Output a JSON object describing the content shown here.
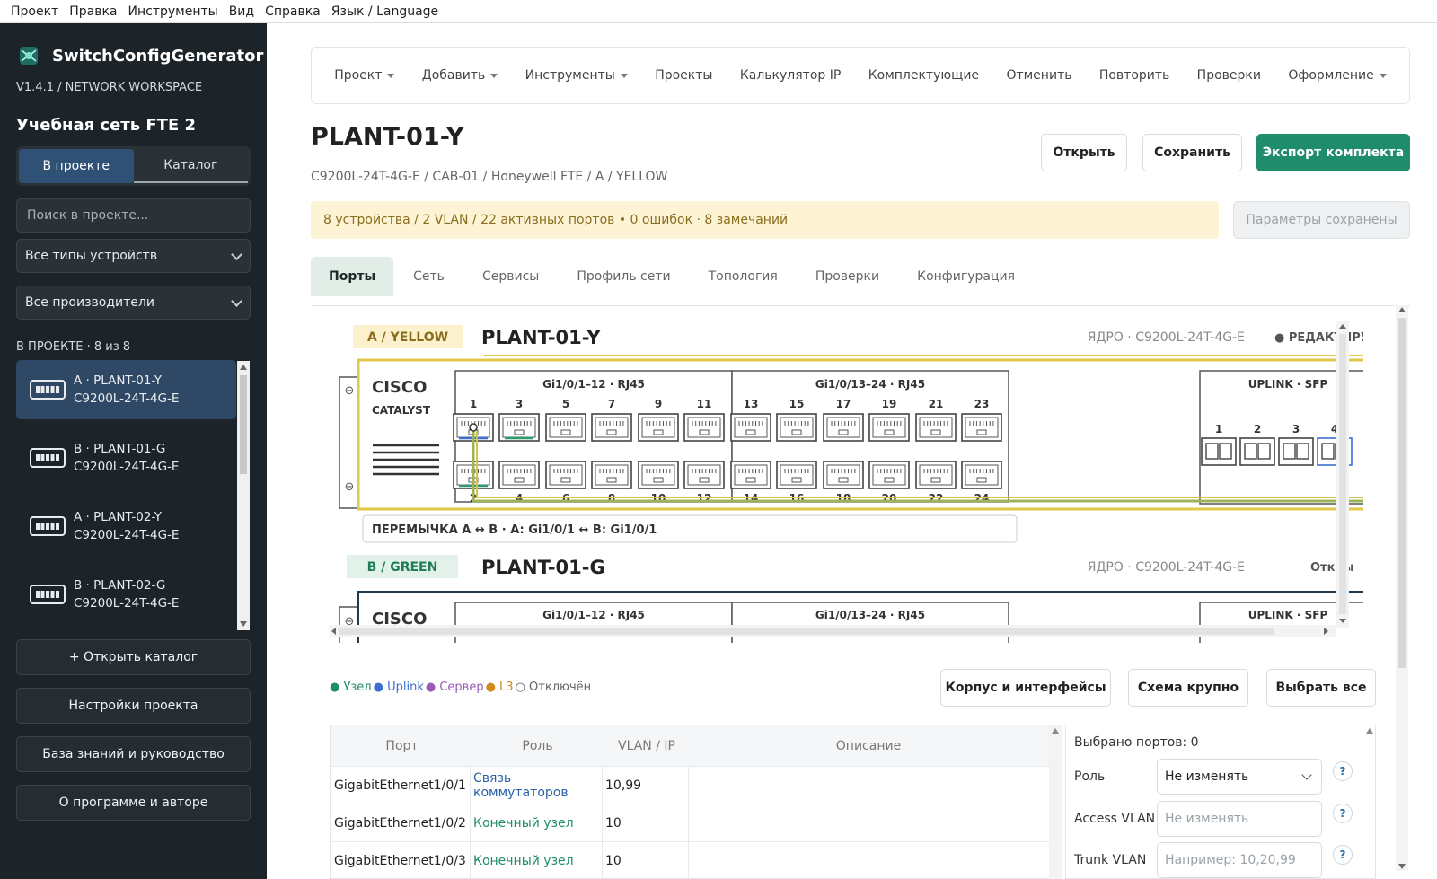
{
  "menubar": [
    "Проект",
    "Правка",
    "Инструменты",
    "Вид",
    "Справка",
    "Язык / Language"
  ],
  "sidebar": {
    "app_name": "SwitchConfigGenerator",
    "version": "V1.4.1   /   NETWORK WORKSPACE",
    "project_title": "Учебная сеть FTE 2",
    "tabs": [
      "В проекте",
      "Каталог"
    ],
    "search_placeholder": "Поиск в проекте...",
    "type_filter": "Все типы устройств",
    "vendor_filter": "Все производители",
    "count_label": "В ПРОЕКТЕ · 8 из 8",
    "devices": [
      {
        "name": "A · PLANT-01-Y",
        "model": "C9200L-24T-4G-E",
        "active": true
      },
      {
        "name": "B · PLANT-01-G",
        "model": "C9200L-24T-4G-E",
        "active": false
      },
      {
        "name": "A · PLANT-02-Y",
        "model": "C9200L-24T-4G-E",
        "active": false
      },
      {
        "name": "B · PLANT-02-G",
        "model": "C9200L-24T-4G-E",
        "active": false
      }
    ],
    "buttons": [
      "+   Открыть каталог",
      "Настройки проекта",
      "База знаний и руководство",
      "О программе и авторе"
    ]
  },
  "toolbar": {
    "items": [
      {
        "label": "Проект",
        "dropdown": true
      },
      {
        "label": "Добавить",
        "dropdown": true
      },
      {
        "label": "Инструменты",
        "dropdown": true
      },
      {
        "label": "Проекты",
        "dropdown": false
      },
      {
        "label": "Калькулятор IP",
        "dropdown": false
      },
      {
        "label": "Комплектующие",
        "dropdown": false
      },
      {
        "label": "Отменить",
        "dropdown": false
      },
      {
        "label": "Повторить",
        "dropdown": false
      },
      {
        "label": "Проверки",
        "dropdown": false
      },
      {
        "label": "Оформление",
        "dropdown": true
      }
    ]
  },
  "device": {
    "title": "PLANT-01-Y",
    "breadcrumb": "C9200L-24T-4G-E   /   CAB-01   /   Honeywell FTE   /   A / YELLOW",
    "open_label": "Открыть",
    "save_label": "Сохранить",
    "export_label": "Экспорт комплекта",
    "summary": "8 устройства   /   2 VLAN   /   22 активных портов     •     0 ошибок   ·   8 замечаний",
    "saved_label": "Параметры сохранены"
  },
  "tabs": [
    "Порты",
    "Сеть",
    "Сервисы",
    "Профиль сети",
    "Топология",
    "Проверки",
    "Конфигурация"
  ],
  "diagram": {
    "a_badge": "A / YELLOW",
    "a_name": "PLANT-01-Y",
    "a_meta": "ЯДРО · C9200L-24T-4G-E",
    "a_status": "● РЕДАКТИРУЕ",
    "brand": "CISCO",
    "series": "CATALYST",
    "group1": "Gi1/0/1–12 · RJ45",
    "group2": "Gi1/0/13–24 · RJ45",
    "uplink": "UPLINK · SFP",
    "top_ports": [
      "1",
      "3",
      "5",
      "7",
      "9",
      "11",
      "13",
      "15",
      "17",
      "19",
      "21",
      "23"
    ],
    "bottom_ports": [
      "2",
      "4",
      "6",
      "8",
      "10",
      "12",
      "14",
      "16",
      "18",
      "20",
      "22",
      "24"
    ],
    "sfp_ports": [
      "1",
      "2",
      "3",
      "4"
    ],
    "jumper": "ПЕРЕМЫЧКА A ↔ B   ·   A: Gi1/0/1 ↔ B: Gi1/0/1",
    "b_badge": "B / GREEN",
    "b_name": "PLANT-01-G",
    "b_meta": "ЯДРО · C9200L-24T-4G-E",
    "b_status": "Откры",
    "colors": {
      "yellow": "#e2c84a",
      "green": "#2e9a6e",
      "blue": "#3b6fd1"
    }
  },
  "legend": [
    {
      "label": "● Узел",
      "color": "#1f8c6c"
    },
    {
      "label": "● Uplink",
      "color": "#3d6fcf"
    },
    {
      "label": "● Сервер",
      "color": "#9b59b6"
    },
    {
      "label": "● L3",
      "color": "#d08a1e"
    },
    {
      "label": "○ Отключён",
      "color": "#666666"
    }
  ],
  "actions": [
    "Корпус и интерфейсы",
    "Схема крупно",
    "Выбрать все"
  ],
  "table": {
    "headers": [
      "Порт",
      "Роль",
      "VLAN / IP",
      "Описание"
    ],
    "rows": [
      {
        "port": "GigabitEthernet1/0/1",
        "role": "Связь коммутаторов",
        "role_kind": "blue",
        "vlan": "10,99",
        "desc": ""
      },
      {
        "port": "GigabitEthernet1/0/2",
        "role": "Конечный узел",
        "role_kind": "green",
        "vlan": "10",
        "desc": ""
      },
      {
        "port": "GigabitEthernet1/0/3",
        "role": "Конечный узел",
        "role_kind": "green",
        "vlan": "10",
        "desc": ""
      }
    ]
  },
  "panel": {
    "selected": "Выбрано портов: 0",
    "role_label": "Роль",
    "role_value": "Не изменять",
    "access_label": "Access VLAN",
    "access_placeholder": "Не изменять",
    "trunk_label": "Trunk VLAN",
    "trunk_placeholder": "Например: 10,20,99",
    "help": "?"
  }
}
